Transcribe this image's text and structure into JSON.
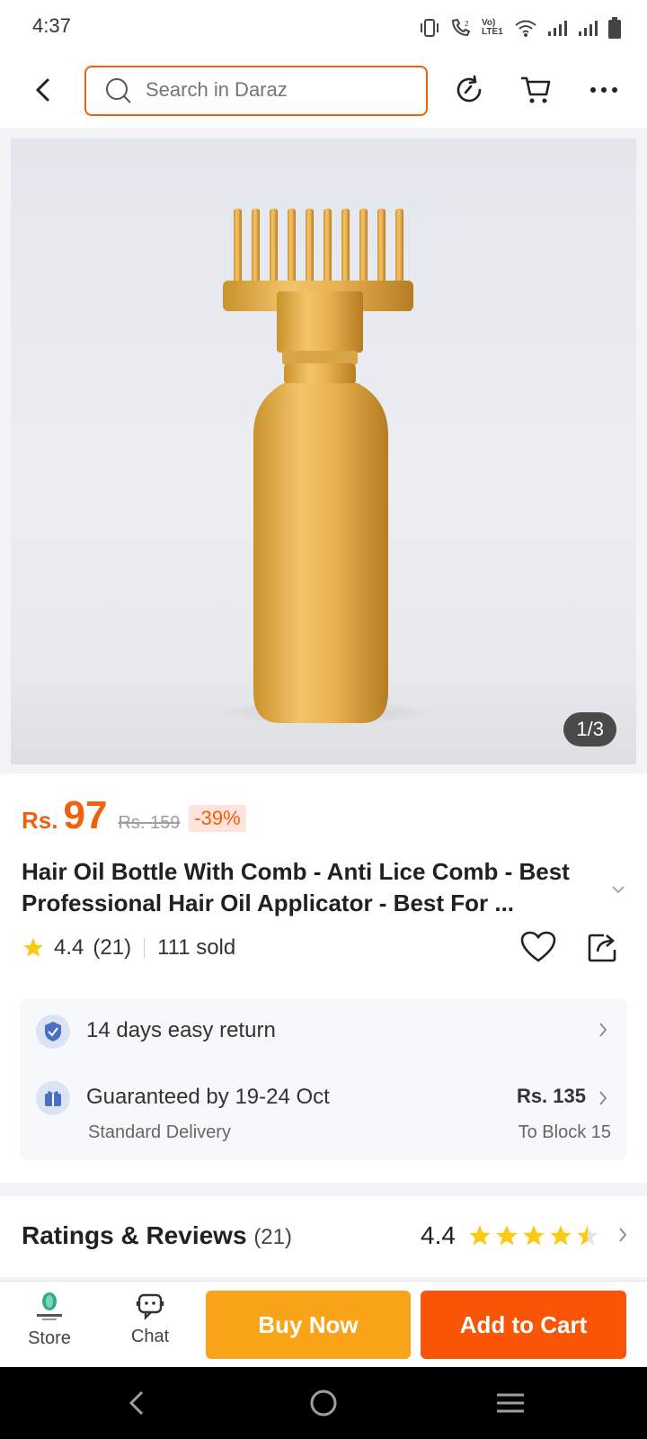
{
  "status_bar": {
    "time": "4:37",
    "indicators": [
      "vibrate-icon",
      "call-icon",
      "volte-icon",
      "wifi-icon",
      "signal-icon",
      "signal-icon",
      "battery-icon"
    ],
    "volte_label": "Vo) LTE1"
  },
  "top_bar": {
    "search_placeholder": "Search in Daraz",
    "icons": [
      "back-icon",
      "search-icon",
      "history-icon",
      "cart-icon",
      "more-icon"
    ]
  },
  "gallery": {
    "counter": "1/3",
    "current": 1,
    "total": 3
  },
  "product": {
    "price_currency": "Rs.",
    "price_value": "97",
    "old_price": "Rs. 159",
    "discount": "-39%",
    "title": "Hair Oil Bottle With Comb - Anti Lice Comb - Best Professional Hair Oil Applicator - Best For ...",
    "rating": "4.4",
    "rating_count": "(21)",
    "sold": "111 sold"
  },
  "services": {
    "return_label": "14 days easy return",
    "delivery_label": "Guaranteed by 19-24 Oct",
    "delivery_type": "Standard Delivery",
    "delivery_price": "Rs. 135",
    "delivery_destination": "To Block 15"
  },
  "reviews": {
    "title": "Ratings & Reviews",
    "count": "(21)",
    "score": "4.4",
    "stars": 4.4
  },
  "bottom_bar": {
    "store_label": "Store",
    "chat_label": "Chat",
    "buy_now_label": "Buy Now",
    "add_to_cart_label": "Add to Cart"
  },
  "nav_bar": {
    "buttons": [
      "nav-back-icon",
      "nav-home-icon",
      "nav-recents-icon"
    ]
  },
  "colors": {
    "accent": "#f85606",
    "buy_now": "#faa41a",
    "star": "#faca15",
    "price": "#f0600f"
  }
}
